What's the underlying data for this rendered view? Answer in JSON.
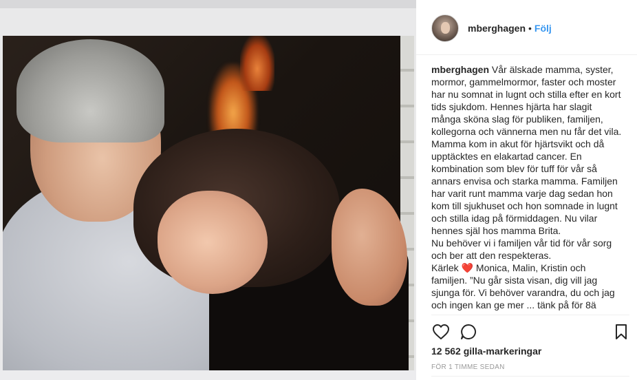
{
  "post": {
    "author": "mberghagen",
    "follow_label": "Följ",
    "separator": "•",
    "caption_user": "mberghagen",
    "caption_paragraphs": [
      "Vår älskade mamma, syster, mormor, gammelmormor, faster och moster har nu somnat in lugnt och stilla efter en kort tids sjukdom. Hennes hjärta har slagit många sköna slag för publiken, familjen, kollegorna och vännerna men nu får det vila. Mamma kom in akut för hjärtsvikt och då upptäcktes en elakartad cancer. En kombination som blev för tuff för vår så annars envisa och starka mamma. Familjen har varit runt mamma varje dag sedan hon kom till sjukhuset och hon somnade in lugnt och stilla idag på förmiddagen. Nu vilar hennes själ hos mamma Brita.",
      "Nu behöver vi i familjen vår tid för vår sorg och ber att den respekteras."
    ],
    "signoff_prefix": "Kärlek",
    "signoff_emoji": "❤️",
    "signoff_suffix": "Monica, Malin, Kristin och familjen. ”Nu går sista visan, dig vill jag sjunga för. Vi behöver varandra, du och jag och ingen kan ge mer ... tänk på för 8ä"
  },
  "actions": {
    "like_icon": "heart-icon",
    "comment_icon": "comment-icon",
    "save_icon": "bookmark-icon"
  },
  "likes_text": "12 562 gilla-markeringar",
  "timestamp_text": "FÖR 1 TIMME SEDAN",
  "colors": {
    "link": "#3897f0",
    "text": "#262626",
    "muted": "#999999",
    "border": "#efefef"
  }
}
